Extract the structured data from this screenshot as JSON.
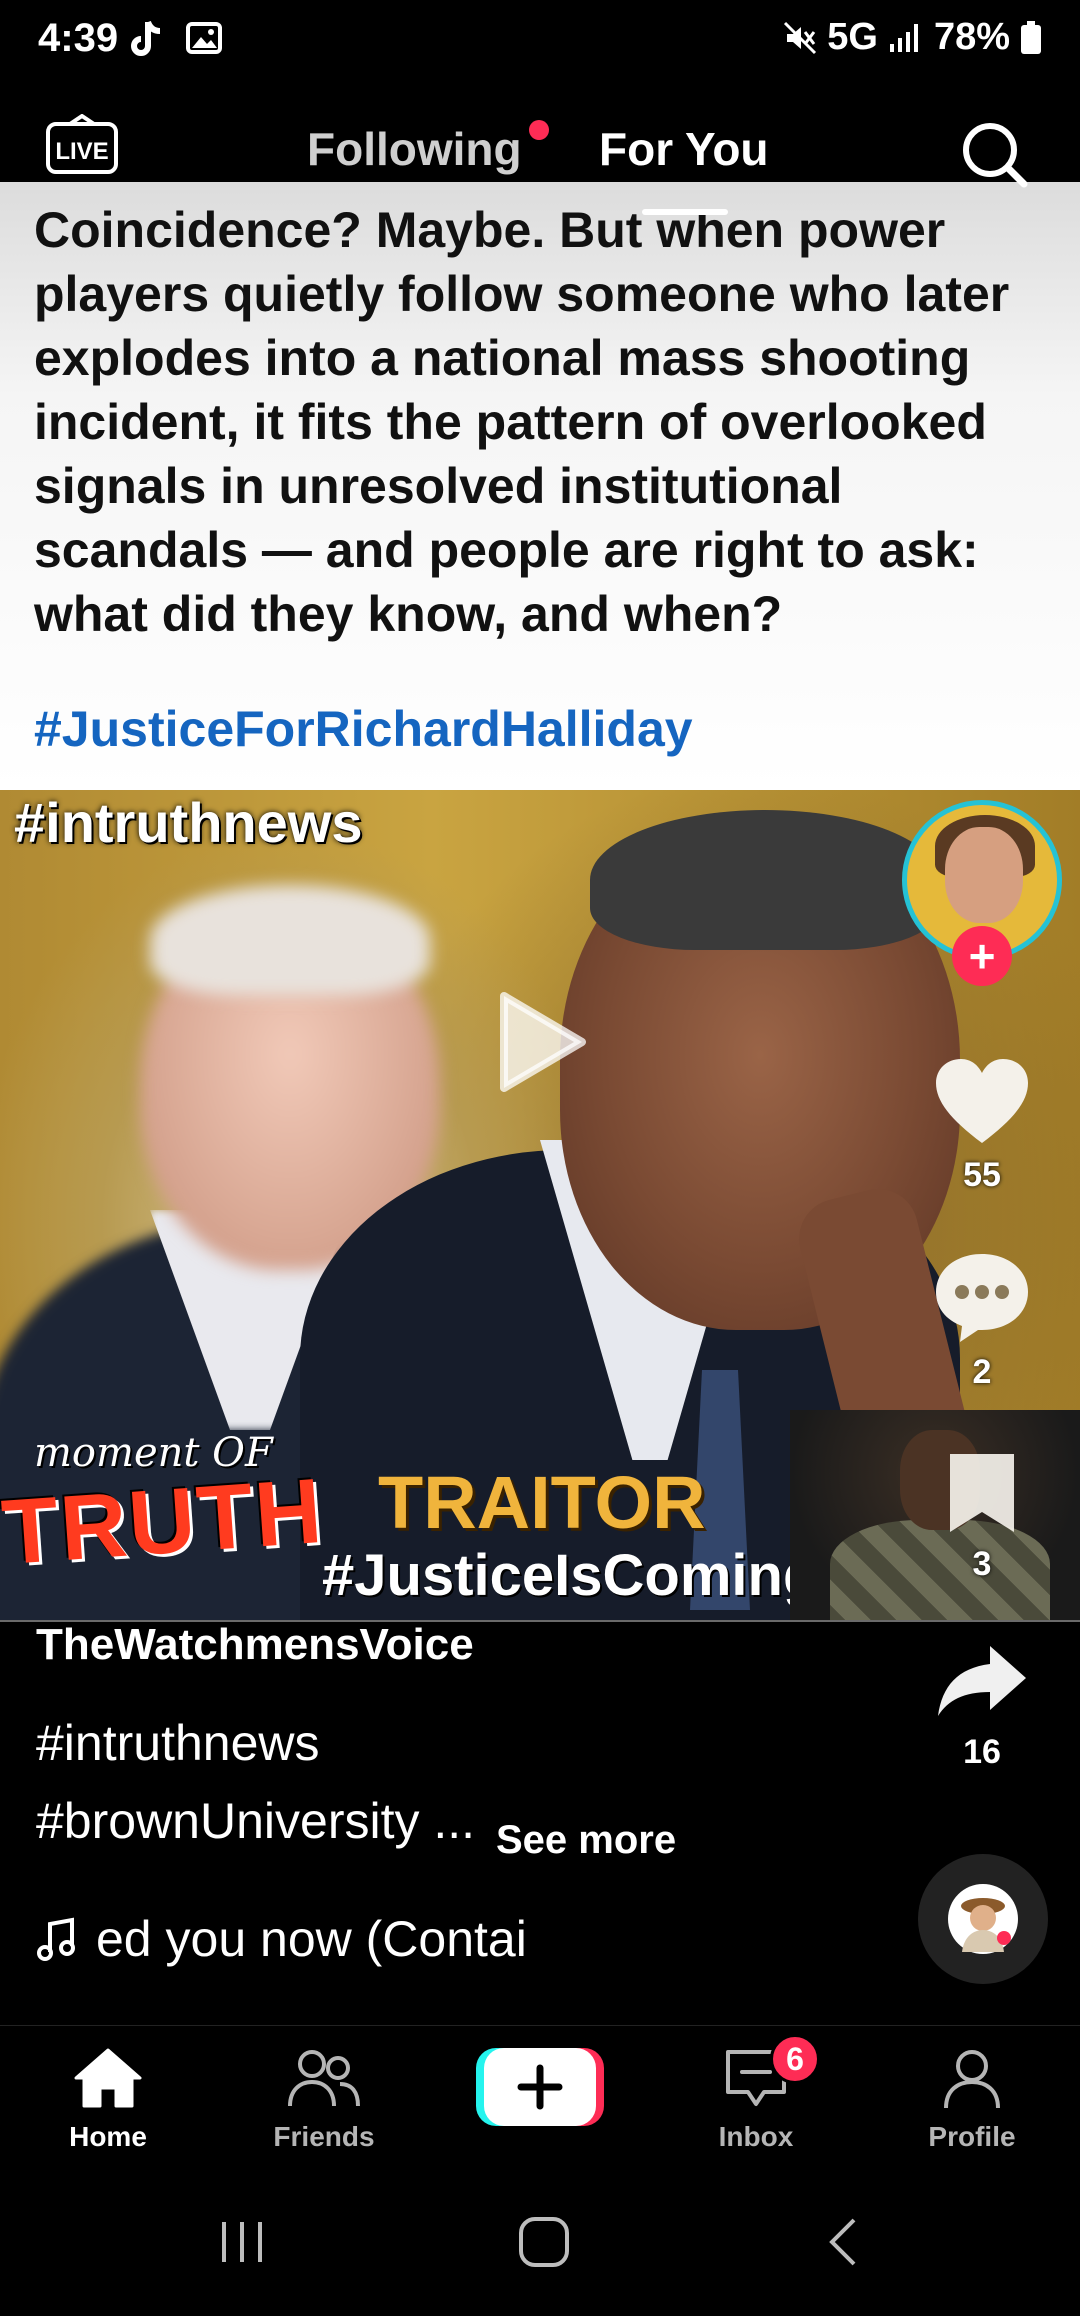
{
  "status_bar": {
    "time": "4:39",
    "network": "5G",
    "battery": "78%",
    "icons_left": [
      "tiktok-icon",
      "gallery-icon"
    ],
    "icons_right": [
      "mute-icon",
      "signal-icon",
      "battery-icon"
    ]
  },
  "top_nav": {
    "live_label": "LIVE",
    "tabs": [
      {
        "label": "Following",
        "has_dot": true
      },
      {
        "label": "For You",
        "active": true
      }
    ]
  },
  "post": {
    "text": "Coincidence? Maybe. But when power\nplayers quietly follow someone who later\nexplodes into a national mass shooting\nincident, it fits the pattern of overlooked\nsignals in unresolved institutional\nscandals — and people are right to ask:\nwhat did they know, and when?",
    "hashtag": "#JusticeForRichardHalliday"
  },
  "video_image": {
    "watermark": "#intruthnews",
    "moment_of": "moment OF",
    "truth": "TRUTH",
    "traitor": "TRAITOR",
    "justice_coming": "#JusticeIsComing"
  },
  "actions": {
    "likes": "55",
    "comments": "2",
    "saves": "3",
    "shares": "16"
  },
  "caption": {
    "author": "TheWatchmensVoice",
    "line1": "#intruthnews",
    "line2": "#brownUniversity ...",
    "see_more": "See more",
    "music": "ed you now (Contai"
  },
  "bottom_nav": {
    "items": [
      {
        "label": "Home",
        "active": true
      },
      {
        "label": "Friends"
      },
      {
        "label": "Inbox",
        "badge": "6"
      },
      {
        "label": "Profile"
      }
    ]
  },
  "colors": {
    "accent": "#fe2c55",
    "link": "#1565c0",
    "avatar_ring": "#25c2d5"
  }
}
